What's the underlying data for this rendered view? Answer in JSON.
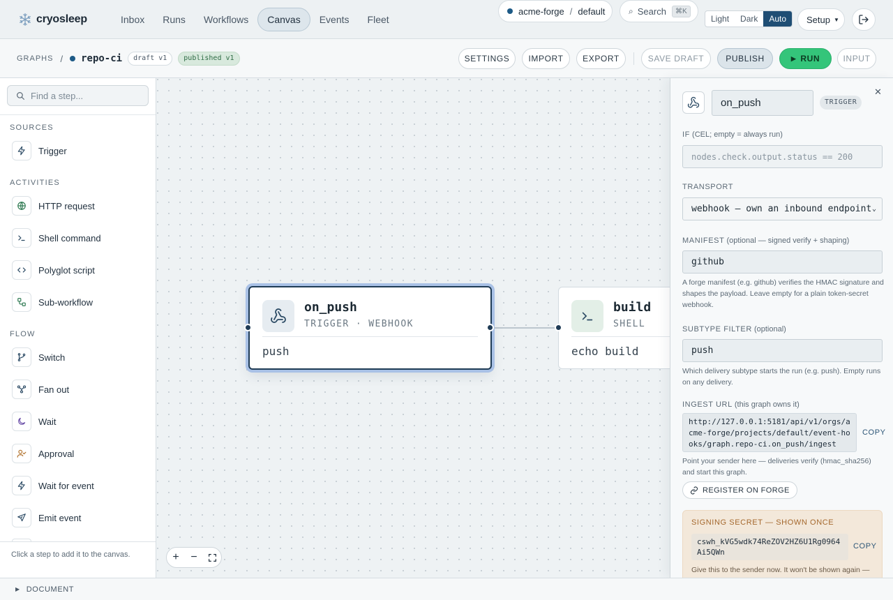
{
  "brand": {
    "name": "cryosleep",
    "icon": "snowflake-icon"
  },
  "nav": [
    {
      "label": "Inbox",
      "active": false
    },
    {
      "label": "Runs",
      "active": false
    },
    {
      "label": "Workflows",
      "active": false
    },
    {
      "label": "Canvas",
      "active": true
    },
    {
      "label": "Events",
      "active": false
    },
    {
      "label": "Fleet",
      "active": false
    }
  ],
  "topbar": {
    "org": "acme-forge",
    "org_sep": "/",
    "project": "default",
    "search_label": "Search",
    "search_shortcut": "⌘K",
    "themes": [
      "Light",
      "Dark",
      "Auto"
    ],
    "active_theme": "Auto",
    "setup_label": "Setup",
    "colors": {
      "accent": "#1f4e74",
      "run": "#34c57a"
    }
  },
  "subbar": {
    "root": "GRAPHS",
    "sep": "/",
    "graph_name": "repo-ci",
    "draft_badge": "draft v1",
    "published_badge": "published v1",
    "buttons": {
      "settings": "SETTINGS",
      "import": "IMPORT",
      "export": "EXPORT",
      "save_draft": "SAVE DRAFT",
      "publish": "PUBLISH",
      "run": "RUN",
      "input": "INPUT"
    }
  },
  "palette": {
    "search_placeholder": "Find a step...",
    "sections": [
      {
        "title": "SOURCES",
        "items": [
          {
            "label": "Trigger",
            "icon": "bolt-icon"
          }
        ]
      },
      {
        "title": "ACTIVITIES",
        "items": [
          {
            "label": "HTTP request",
            "icon": "globe-icon"
          },
          {
            "label": "Shell command",
            "icon": "terminal-icon"
          },
          {
            "label": "Polyglot script",
            "icon": "code-icon"
          },
          {
            "label": "Sub-workflow",
            "icon": "subflow-icon"
          }
        ]
      },
      {
        "title": "FLOW",
        "items": [
          {
            "label": "Switch",
            "icon": "branch-icon"
          },
          {
            "label": "Fan out",
            "icon": "fan-out-icon"
          },
          {
            "label": "Wait",
            "icon": "moon-icon"
          },
          {
            "label": "Approval",
            "icon": "user-check-icon"
          },
          {
            "label": "Wait for event",
            "icon": "bolt-icon"
          },
          {
            "label": "Emit event",
            "icon": "send-icon"
          }
        ]
      }
    ],
    "footer": "Click a step to add it to the canvas."
  },
  "canvas": {
    "nodes": [
      {
        "title": "on_push",
        "subtitle": "TRIGGER · WEBHOOK",
        "body": "push",
        "icon": "webhook-icon",
        "selected": true
      },
      {
        "title": "build",
        "subtitle": "SHELL",
        "body": "echo build",
        "icon": "terminal-icon",
        "selected": false
      }
    ],
    "zoom_controls": [
      "+",
      "−",
      "fit"
    ]
  },
  "inspector": {
    "name": "on_push",
    "type_tag": "TRIGGER",
    "if_label": "IF",
    "if_hint": "(CEL; empty = always run)",
    "if_placeholder": "nodes.check.output.status == 200",
    "transport_label": "TRANSPORT",
    "transport_value": "webhook — own an inbound endpoint",
    "manifest_label": "MANIFEST",
    "manifest_hint": "(optional — signed verify + shaping)",
    "manifest_value": "github",
    "manifest_help": "A forge manifest (e.g. github) verifies the HMAC signature and shapes the payload. Leave empty for a plain token-secret webhook.",
    "subtype_label": "SUBTYPE FILTER",
    "subtype_hint": "(optional)",
    "subtype_value": "push",
    "subtype_help": "Which delivery subtype starts the run (e.g. push). Empty runs on any delivery.",
    "ingest_label": "INGEST URL",
    "ingest_hint": "(this graph owns it)",
    "ingest_url": "http://127.0.0.1:5181/api/v1/orgs/acme-forge/projects/default/event-hooks/graph.repo-ci.on_push/ingest",
    "copy_label": "COPY",
    "ingest_help": "Point your sender here — deliveries verify (hmac_sha256) and start this graph.",
    "register_label": "REGISTER ON FORGE",
    "secret_title": "SIGNING SECRET — SHOWN ONCE",
    "secret_value": "cswh_kVG5wdk74ReZOV2HZ6U1Rg0964Ai5QWn",
    "secret_help": "Give this to the sender now. It won't be shown again —"
  },
  "docbar": {
    "label": "DOCUMENT"
  }
}
